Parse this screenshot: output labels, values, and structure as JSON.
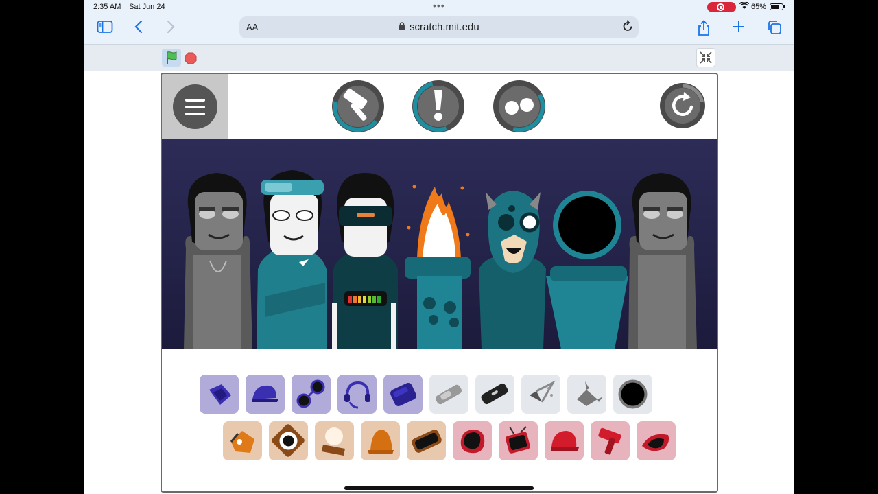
{
  "status_bar": {
    "time": "2:35 AM",
    "date": "Sat Jun 24",
    "battery": "65%"
  },
  "browser": {
    "text_size_label": "AA",
    "url": "scratch.mit.edu"
  },
  "colors": {
    "accent": "#1a73e8",
    "teal": "#1f7f8c",
    "record": "#d9263a",
    "purple_tile": "#b1abda",
    "gray_tile": "#e4e8ec",
    "tan_tile": "#e8c9ae",
    "red_tile": "#e7b3bc"
  },
  "game": {
    "top_buttons": [
      "hamburger-menu",
      "hammer-mode",
      "exclamation-mode",
      "eyes-mode",
      "reset"
    ],
    "characters": [
      "gray-singer",
      "goggles-singer",
      "visor-singer",
      "fire-singer",
      "horned-singer",
      "hole-singer",
      "gray-singer-2"
    ],
    "icon_row_1": [
      "purple-hood",
      "purple-cap",
      "purple-glasses",
      "purple-headphones",
      "purple-helmet",
      "gray-goggles",
      "gray-visor",
      "gray-spark",
      "gray-horn",
      "black-hole"
    ],
    "icon_row_2": [
      "orange-beast",
      "orange-eye",
      "orange-moon",
      "orange-hat",
      "orange-mask",
      "red-blob",
      "red-tv",
      "red-cap",
      "red-hammer",
      "red-visor"
    ]
  }
}
